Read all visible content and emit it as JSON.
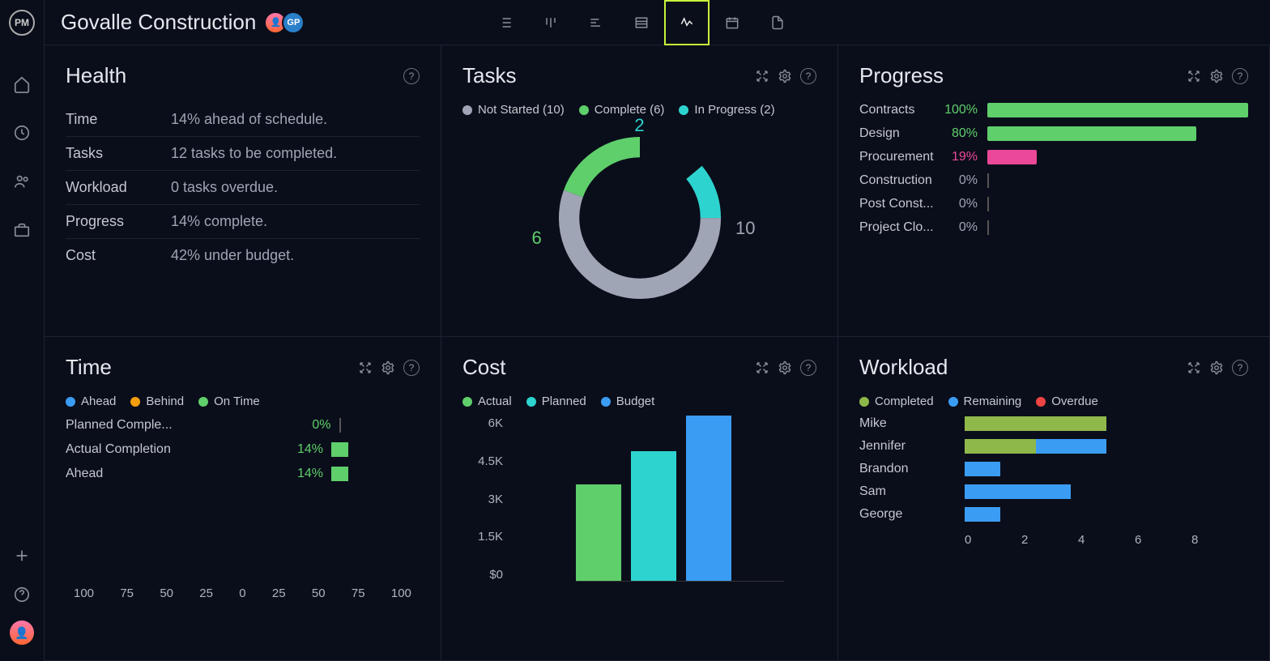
{
  "project_title": "Govalle Construction",
  "avatars": [
    {
      "initials": ""
    },
    {
      "initials": "GP"
    }
  ],
  "colors": {
    "green": "#5fcf6c",
    "teal": "#2dd4cf",
    "gray": "#9fa5b5",
    "pink": "#ec4899",
    "blue": "#3b9cf4",
    "olive": "#8fb84a",
    "orange": "#f59e0b",
    "red": "#ef4444"
  },
  "health": {
    "title": "Health",
    "rows": [
      {
        "label": "Time",
        "value": "14% ahead of schedule."
      },
      {
        "label": "Tasks",
        "value": "12 tasks to be completed."
      },
      {
        "label": "Workload",
        "value": "0 tasks overdue."
      },
      {
        "label": "Progress",
        "value": "14% complete."
      },
      {
        "label": "Cost",
        "value": "42% under budget."
      }
    ]
  },
  "tasks": {
    "title": "Tasks",
    "legend": [
      {
        "label": "Not Started (10)",
        "color": "#9fa5b5"
      },
      {
        "label": "Complete (6)",
        "color": "#5fcf6c"
      },
      {
        "label": "In Progress (2)",
        "color": "#2dd4cf"
      }
    ],
    "chart_data": {
      "type": "donut",
      "series": [
        {
          "name": "Not Started",
          "value": 10,
          "color": "#9fa5b5"
        },
        {
          "name": "Complete",
          "value": 6,
          "color": "#5fcf6c"
        },
        {
          "name": "In Progress",
          "value": 2,
          "color": "#2dd4cf"
        }
      ]
    },
    "labels": {
      "top": "2",
      "left": "6",
      "right": "10"
    }
  },
  "progress": {
    "title": "Progress",
    "rows": [
      {
        "label": "Contracts",
        "pct": "100%",
        "value": 100,
        "color": "#5fcf6c",
        "pctColor": "#5fcf6c"
      },
      {
        "label": "Design",
        "pct": "80%",
        "value": 80,
        "color": "#5fcf6c",
        "pctColor": "#5fcf6c"
      },
      {
        "label": "Procurement",
        "pct": "19%",
        "value": 19,
        "color": "#ec4899",
        "pctColor": "#ec4899"
      },
      {
        "label": "Construction",
        "pct": "0%",
        "value": 0,
        "color": "#555",
        "pctColor": "#9fa5b5"
      },
      {
        "label": "Post Const...",
        "pct": "0%",
        "value": 0,
        "color": "#555",
        "pctColor": "#9fa5b5"
      },
      {
        "label": "Project Clo...",
        "pct": "0%",
        "value": 0,
        "color": "#555",
        "pctColor": "#9fa5b5"
      }
    ]
  },
  "time": {
    "title": "Time",
    "legend": [
      {
        "label": "Ahead",
        "color": "#3b9cf4"
      },
      {
        "label": "Behind",
        "color": "#f59e0b"
      },
      {
        "label": "On Time",
        "color": "#5fcf6c"
      }
    ],
    "rows": [
      {
        "label": "Planned Comple...",
        "pct": "0%",
        "value": 0
      },
      {
        "label": "Actual Completion",
        "pct": "14%",
        "value": 14
      },
      {
        "label": "Ahead",
        "pct": "14%",
        "value": 14
      }
    ],
    "axis": [
      "100",
      "75",
      "50",
      "25",
      "0",
      "25",
      "50",
      "75",
      "100"
    ]
  },
  "cost": {
    "title": "Cost",
    "legend": [
      {
        "label": "Actual",
        "color": "#5fcf6c"
      },
      {
        "label": "Planned",
        "color": "#2dd4cf"
      },
      {
        "label": "Budget",
        "color": "#3b9cf4"
      }
    ],
    "chart_data": {
      "type": "bar",
      "categories": [
        "Actual",
        "Planned",
        "Budget"
      ],
      "values": [
        3500,
        4700,
        6000
      ],
      "ylim": [
        0,
        6000
      ],
      "ylabel": "",
      "title": ""
    },
    "yaxis": [
      "6K",
      "4.5K",
      "3K",
      "1.5K",
      "$0"
    ]
  },
  "workload": {
    "title": "Workload",
    "legend": [
      {
        "label": "Completed",
        "color": "#8fb84a"
      },
      {
        "label": "Remaining",
        "color": "#3b9cf4"
      },
      {
        "label": "Overdue",
        "color": "#ef4444"
      }
    ],
    "chart_data": {
      "type": "stacked-bar",
      "categories": [
        "Mike",
        "Jennifer",
        "Brandon",
        "Sam",
        "George"
      ],
      "series": [
        {
          "name": "Completed",
          "values": [
            4,
            2,
            0,
            0,
            0
          ]
        },
        {
          "name": "Remaining",
          "values": [
            0,
            2,
            1,
            3,
            1
          ]
        },
        {
          "name": "Overdue",
          "values": [
            0,
            0,
            0,
            0,
            0
          ]
        }
      ],
      "xlim": [
        0,
        8
      ]
    },
    "rows": [
      {
        "label": "Mike",
        "segs": [
          {
            "w": 4,
            "c": "#8fb84a"
          }
        ]
      },
      {
        "label": "Jennifer",
        "segs": [
          {
            "w": 2,
            "c": "#8fb84a"
          },
          {
            "w": 2,
            "c": "#3b9cf4"
          }
        ]
      },
      {
        "label": "Brandon",
        "segs": [
          {
            "w": 1,
            "c": "#3b9cf4"
          }
        ]
      },
      {
        "label": "Sam",
        "segs": [
          {
            "w": 3,
            "c": "#3b9cf4"
          }
        ]
      },
      {
        "label": "George",
        "segs": [
          {
            "w": 1,
            "c": "#3b9cf4"
          }
        ]
      }
    ],
    "axis": [
      "0",
      "2",
      "4",
      "6",
      "8"
    ]
  }
}
